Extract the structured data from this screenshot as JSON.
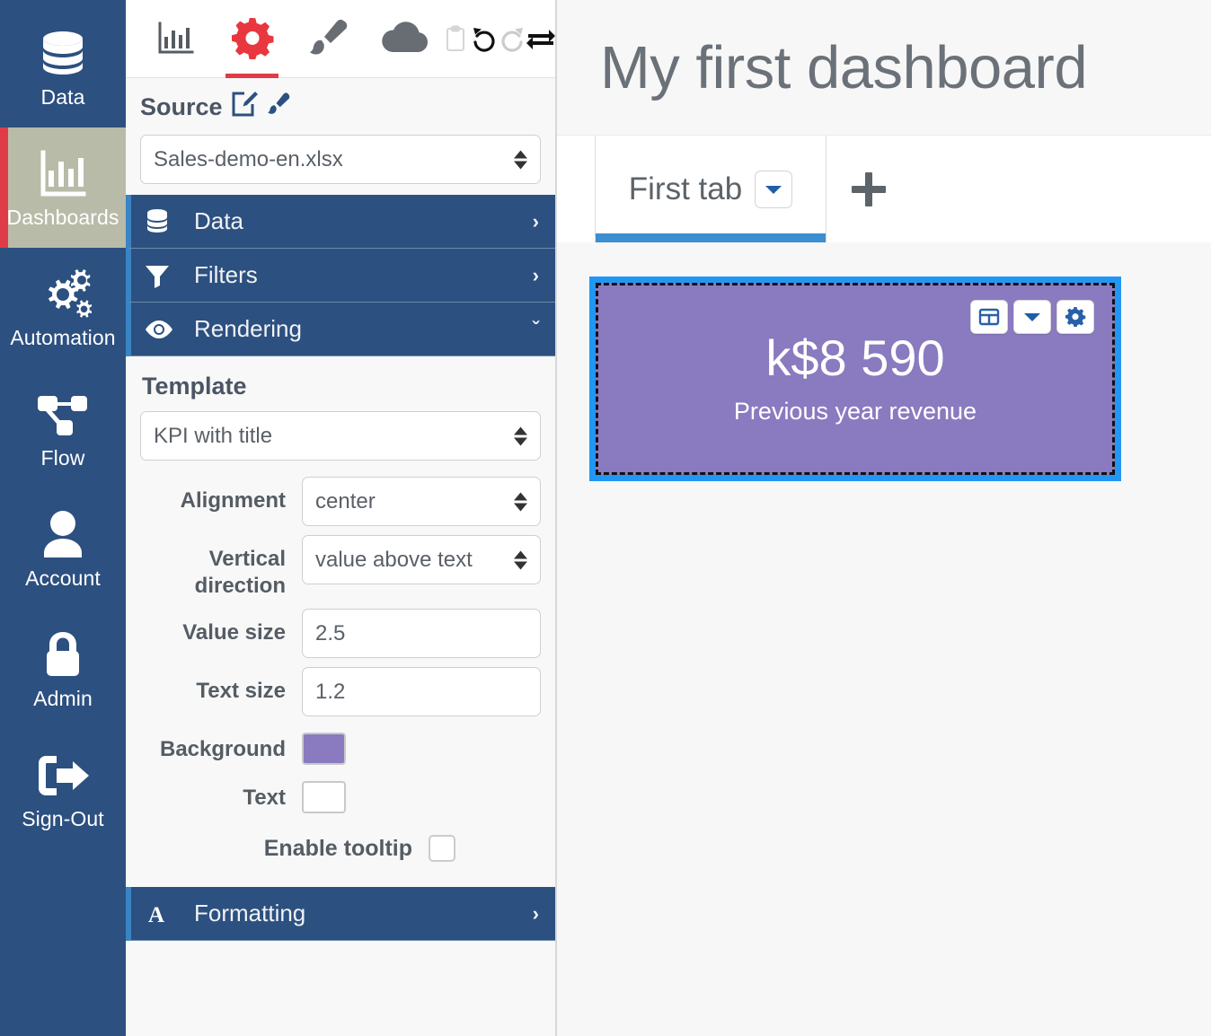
{
  "sidebar": {
    "items": [
      {
        "label": "Data",
        "icon": "database-icon",
        "active": false
      },
      {
        "label": "Dashboards",
        "icon": "bar-chart-icon",
        "active": true
      },
      {
        "label": "Automation",
        "icon": "gears-icon",
        "active": false
      },
      {
        "label": "Flow",
        "icon": "flow-nodes-icon",
        "active": false
      },
      {
        "label": "Account",
        "icon": "user-icon",
        "active": false
      },
      {
        "label": "Admin",
        "icon": "lock-icon",
        "active": false
      },
      {
        "label": "Sign-Out",
        "icon": "sign-out-icon",
        "active": false
      }
    ],
    "active_bg": "#b9bba9",
    "accent": "#e03c48",
    "bg": "#2c5080"
  },
  "panel": {
    "toolbar": {
      "items": [
        {
          "name": "chart-icon",
          "title": "Chart",
          "active": false
        },
        {
          "name": "gear-icon",
          "title": "Settings",
          "active": true
        },
        {
          "name": "paintbrush-icon",
          "title": "Style",
          "active": false
        },
        {
          "name": "cloud-icon",
          "title": "Cloud",
          "active": false
        },
        {
          "name": "clipboard-icon",
          "title": "Paste",
          "active": false
        },
        {
          "name": "undo-icon",
          "title": "Undo",
          "active": false
        },
        {
          "name": "redo-icon",
          "title": "Redo",
          "active": false
        },
        {
          "name": "swap-icon",
          "title": "Swap",
          "active": false
        }
      ],
      "active_accent": "#e03c48"
    },
    "source": {
      "title": "Source",
      "edit_icon": "edit-square-icon",
      "brush_icon": "paintbrush-icon",
      "select_value": "Sales-demo-en.xlsx"
    },
    "sections": [
      {
        "label": "Data",
        "icon": "database-icon",
        "caret": "›",
        "expanded": false
      },
      {
        "label": "Filters",
        "icon": "funnel-icon",
        "caret": "›",
        "expanded": false
      },
      {
        "label": "Rendering",
        "icon": "eye-icon",
        "caret": "ˇ",
        "expanded": true
      }
    ],
    "rendering": {
      "template_title": "Template",
      "template_value": "KPI with title",
      "fields": [
        {
          "label": "Alignment",
          "type": "select",
          "value": "center"
        },
        {
          "label": "Vertical direction",
          "type": "select",
          "value": "value above text"
        },
        {
          "label": "Value size",
          "type": "text",
          "value": "2.5"
        },
        {
          "label": "Text size",
          "type": "text",
          "value": "1.2"
        },
        {
          "label": "Background",
          "type": "color",
          "value": "#8a7ac0"
        },
        {
          "label": "Text",
          "type": "color",
          "value": "#ffffff"
        }
      ],
      "tooltip_label": "Enable tooltip",
      "tooltip_checked": false
    },
    "formatting": {
      "label": "Formatting",
      "icon": "font-a-icon",
      "caret": "›"
    }
  },
  "dashboard": {
    "title": "My first dashboard",
    "tabs": [
      {
        "label": "First tab",
        "active": true,
        "caret_icon": "chevron-down-icon"
      }
    ],
    "add_tab_icon": "plus-icon",
    "tab_accent": "#3b8ed0",
    "widget": {
      "value": "k$8 590",
      "text": "Previous year revenue",
      "background": "#8a7ac0",
      "text_color": "#ffffff",
      "selection_color": "#2196f3",
      "tools": [
        {
          "name": "table-icon",
          "title": "Table view"
        },
        {
          "name": "chevron-down-icon",
          "title": "More"
        },
        {
          "name": "gear-icon",
          "title": "Widget settings"
        }
      ]
    }
  }
}
